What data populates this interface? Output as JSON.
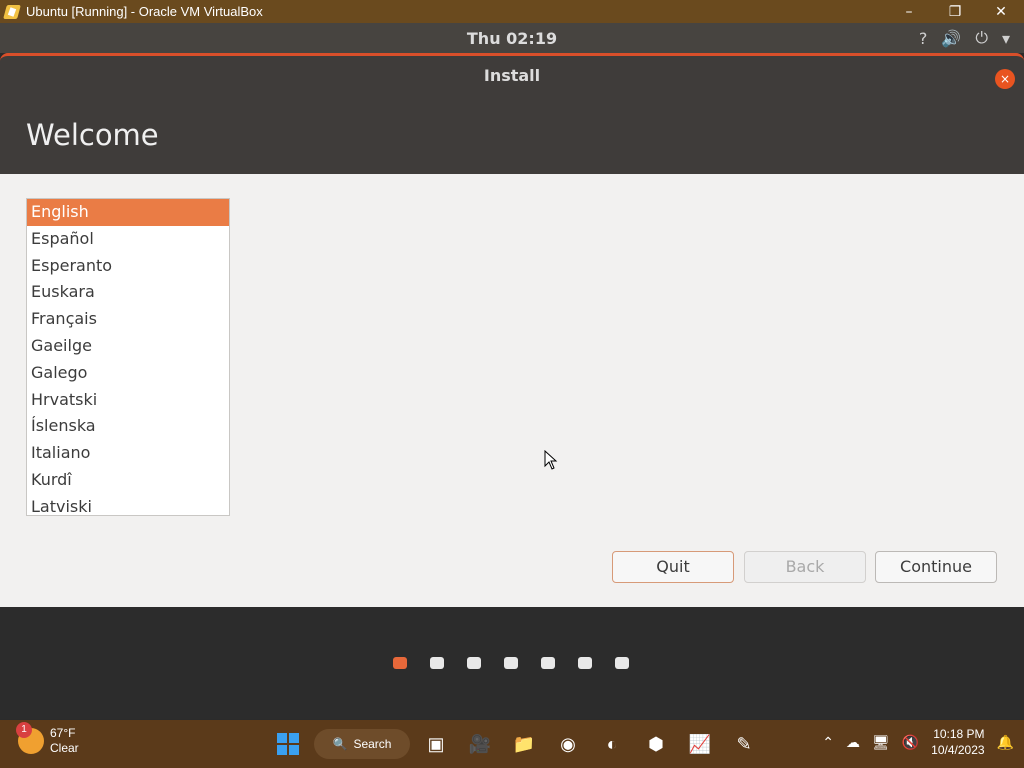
{
  "vbox": {
    "title": "Ubuntu [Running] - Oracle VM VirtualBox",
    "minimize": "–",
    "restore": "❐",
    "close": "✕"
  },
  "ubuntu_panel": {
    "clock": "Thu 02:19",
    "status_icons": {
      "accessibility": "?",
      "volume": "🔊",
      "power": "⏻",
      "menu": "▾"
    }
  },
  "installer": {
    "window_title": "Install",
    "heading": "Welcome",
    "languages": [
      "English",
      "Español",
      "Esperanto",
      "Euskara",
      "Français",
      "Gaeilge",
      "Galego",
      "Hrvatski",
      "Íslenska",
      "Italiano",
      "Kurdî",
      "Latviski"
    ],
    "selected_language": "English",
    "buttons": {
      "quit": "Quit",
      "back": "Back",
      "continue": "Continue"
    },
    "close_symbol": "×"
  },
  "slideshow": {
    "total_steps": 7,
    "active_step": 1
  },
  "taskbar": {
    "weather": {
      "temp": "67°F",
      "condition": "Clear",
      "badge": "1"
    },
    "search_label": "Search",
    "time": "10:18 PM",
    "date": "10/4/2023"
  },
  "colors": {
    "accent": "#e95420",
    "selected": "#ea7c45"
  }
}
